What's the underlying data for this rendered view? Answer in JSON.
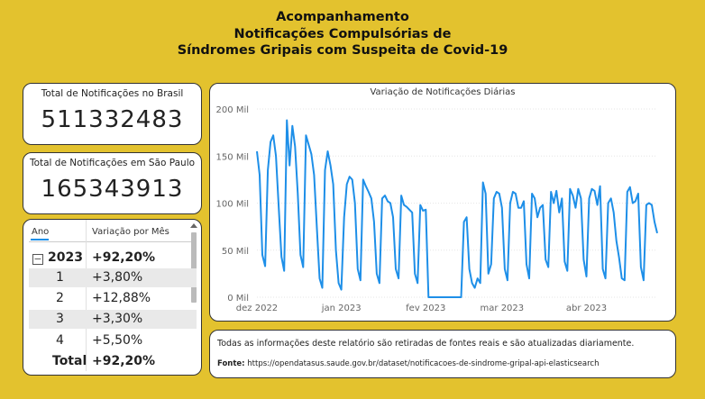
{
  "header": {
    "title_line1": "Acompanhamento",
    "title_line2": "Notificações Compulsórias de",
    "title_line3": "Síndromes Gripais com Suspeita de Covid-19"
  },
  "kpi_brasil": {
    "label": "Total de Notificações no Brasil",
    "value": "511332483"
  },
  "kpi_sp": {
    "label": "Total de Notificações em São Paulo",
    "value": "165343913"
  },
  "matrix": {
    "col_ano": "Ano",
    "col_var": "Variação por Mês",
    "group": {
      "year": "2023",
      "value": "+92,20%"
    },
    "rows": [
      {
        "mes": "1",
        "valor": "+3,80%"
      },
      {
        "mes": "2",
        "valor": "+12,88%"
      },
      {
        "mes": "3",
        "valor": "+3,30%"
      },
      {
        "mes": "4",
        "valor": "+5,50%"
      }
    ],
    "total": {
      "label": "Total",
      "value": "+92,20%"
    },
    "expander_symbol": "−"
  },
  "chart_data": {
    "type": "line",
    "title": "Variação de Notificações Diárias",
    "ylim": [
      0,
      200000
    ],
    "y_ticks": [
      {
        "value": 0,
        "label": "0 Mil"
      },
      {
        "value": 50000,
        "label": "50 Mil"
      },
      {
        "value": 100000,
        "label": "100 Mil"
      },
      {
        "value": 150000,
        "label": "150 Mil"
      },
      {
        "value": 200000,
        "label": "200 Mil"
      }
    ],
    "x_ticks": [
      {
        "date": "2022-12-01",
        "label": "dez 2022"
      },
      {
        "date": "2023-01-01",
        "label": "jan 2023"
      },
      {
        "date": "2023-02-01",
        "label": "fev 2023"
      },
      {
        "date": "2023-03-01",
        "label": "mar 2023"
      },
      {
        "date": "2023-04-01",
        "label": "abr 2023"
      }
    ],
    "x_range": [
      "2022-12-01",
      "2023-04-27"
    ],
    "line_color": "#1E8FE8",
    "grid": "horizontal",
    "points": [
      [
        "2022-12-01",
        155000
      ],
      [
        "2022-12-02",
        130000
      ],
      [
        "2022-12-03",
        45000
      ],
      [
        "2022-12-04",
        33000
      ],
      [
        "2022-12-05",
        135000
      ],
      [
        "2022-12-06",
        165000
      ],
      [
        "2022-12-07",
        172000
      ],
      [
        "2022-12-08",
        150000
      ],
      [
        "2022-12-09",
        95000
      ],
      [
        "2022-12-10",
        43000
      ],
      [
        "2022-12-11",
        28000
      ],
      [
        "2022-12-12",
        188000
      ],
      [
        "2022-12-13",
        140000
      ],
      [
        "2022-12-14",
        182000
      ],
      [
        "2022-12-15",
        160000
      ],
      [
        "2022-12-16",
        110000
      ],
      [
        "2022-12-17",
        45000
      ],
      [
        "2022-12-18",
        32000
      ],
      [
        "2022-12-19",
        172000
      ],
      [
        "2022-12-20",
        162000
      ],
      [
        "2022-12-21",
        152000
      ],
      [
        "2022-12-22",
        130000
      ],
      [
        "2022-12-23",
        75000
      ],
      [
        "2022-12-24",
        20000
      ],
      [
        "2022-12-25",
        10000
      ],
      [
        "2022-12-26",
        135000
      ],
      [
        "2022-12-27",
        155000
      ],
      [
        "2022-12-28",
        140000
      ],
      [
        "2022-12-29",
        120000
      ],
      [
        "2022-12-30",
        50000
      ],
      [
        "2022-12-31",
        15000
      ],
      [
        "2023-01-01",
        8000
      ],
      [
        "2023-01-02",
        85000
      ],
      [
        "2023-01-03",
        120000
      ],
      [
        "2023-01-04",
        128000
      ],
      [
        "2023-01-05",
        125000
      ],
      [
        "2023-01-06",
        100000
      ],
      [
        "2023-01-07",
        30000
      ],
      [
        "2023-01-08",
        18000
      ],
      [
        "2023-01-09",
        125000
      ],
      [
        "2023-01-10",
        118000
      ],
      [
        "2023-01-11",
        112000
      ],
      [
        "2023-01-12",
        105000
      ],
      [
        "2023-01-13",
        80000
      ],
      [
        "2023-01-14",
        25000
      ],
      [
        "2023-01-15",
        15000
      ],
      [
        "2023-01-16",
        105000
      ],
      [
        "2023-01-17",
        108000
      ],
      [
        "2023-01-18",
        102000
      ],
      [
        "2023-01-19",
        100000
      ],
      [
        "2023-01-20",
        85000
      ],
      [
        "2023-01-21",
        30000
      ],
      [
        "2023-01-22",
        20000
      ],
      [
        "2023-01-23",
        108000
      ],
      [
        "2023-01-24",
        98000
      ],
      [
        "2023-01-25",
        96000
      ],
      [
        "2023-01-26",
        93000
      ],
      [
        "2023-01-27",
        90000
      ],
      [
        "2023-01-28",
        25000
      ],
      [
        "2023-01-29",
        15000
      ],
      [
        "2023-01-30",
        98000
      ],
      [
        "2023-01-31",
        92000
      ],
      [
        "2023-02-01",
        93000
      ],
      [
        "2023-02-02",
        0
      ],
      [
        "2023-02-03",
        0
      ],
      [
        "2023-02-04",
        0
      ],
      [
        "2023-02-05",
        0
      ],
      [
        "2023-02-06",
        0
      ],
      [
        "2023-02-07",
        0
      ],
      [
        "2023-02-08",
        0
      ],
      [
        "2023-02-09",
        0
      ],
      [
        "2023-02-10",
        0
      ],
      [
        "2023-02-11",
        0
      ],
      [
        "2023-02-12",
        0
      ],
      [
        "2023-02-13",
        0
      ],
      [
        "2023-02-14",
        0
      ],
      [
        "2023-02-15",
        80000
      ],
      [
        "2023-02-16",
        85000
      ],
      [
        "2023-02-17",
        30000
      ],
      [
        "2023-02-18",
        15000
      ],
      [
        "2023-02-19",
        10000
      ],
      [
        "2023-02-20",
        20000
      ],
      [
        "2023-02-21",
        15000
      ],
      [
        "2023-02-22",
        122000
      ],
      [
        "2023-02-23",
        110000
      ],
      [
        "2023-02-24",
        25000
      ],
      [
        "2023-02-25",
        35000
      ],
      [
        "2023-02-26",
        105000
      ],
      [
        "2023-02-27",
        112000
      ],
      [
        "2023-02-28",
        110000
      ],
      [
        "2023-03-01",
        95000
      ],
      [
        "2023-03-02",
        30000
      ],
      [
        "2023-03-03",
        18000
      ],
      [
        "2023-03-04",
        100000
      ],
      [
        "2023-03-05",
        112000
      ],
      [
        "2023-03-06",
        110000
      ],
      [
        "2023-03-07",
        95000
      ],
      [
        "2023-03-08",
        95000
      ],
      [
        "2023-03-09",
        102000
      ],
      [
        "2023-03-10",
        35000
      ],
      [
        "2023-03-11",
        20000
      ],
      [
        "2023-03-12",
        110000
      ],
      [
        "2023-03-13",
        105000
      ],
      [
        "2023-03-14",
        85000
      ],
      [
        "2023-03-15",
        95000
      ],
      [
        "2023-03-16",
        98000
      ],
      [
        "2023-03-17",
        40000
      ],
      [
        "2023-03-18",
        32000
      ],
      [
        "2023-03-19",
        112000
      ],
      [
        "2023-03-20",
        100000
      ],
      [
        "2023-03-21",
        113000
      ],
      [
        "2023-03-22",
        90000
      ],
      [
        "2023-03-23",
        105000
      ],
      [
        "2023-03-24",
        38000
      ],
      [
        "2023-03-25",
        28000
      ],
      [
        "2023-03-26",
        115000
      ],
      [
        "2023-03-27",
        108000
      ],
      [
        "2023-03-28",
        95000
      ],
      [
        "2023-03-29",
        115000
      ],
      [
        "2023-03-30",
        105000
      ],
      [
        "2023-03-31",
        40000
      ],
      [
        "2023-04-01",
        22000
      ],
      [
        "2023-04-02",
        105000
      ],
      [
        "2023-04-03",
        115000
      ],
      [
        "2023-04-04",
        113000
      ],
      [
        "2023-04-05",
        98000
      ],
      [
        "2023-04-06",
        118000
      ],
      [
        "2023-04-07",
        30000
      ],
      [
        "2023-04-08",
        20000
      ],
      [
        "2023-04-09",
        100000
      ],
      [
        "2023-04-10",
        105000
      ],
      [
        "2023-04-11",
        90000
      ],
      [
        "2023-04-12",
        60000
      ],
      [
        "2023-04-13",
        42000
      ],
      [
        "2023-04-14",
        20000
      ],
      [
        "2023-04-15",
        18000
      ],
      [
        "2023-04-16",
        112000
      ],
      [
        "2023-04-17",
        117000
      ],
      [
        "2023-04-18",
        100000
      ],
      [
        "2023-04-19",
        102000
      ],
      [
        "2023-04-20",
        110000
      ],
      [
        "2023-04-21",
        32000
      ],
      [
        "2023-04-22",
        18000
      ],
      [
        "2023-04-23",
        98000
      ],
      [
        "2023-04-24",
        100000
      ],
      [
        "2023-04-25",
        98000
      ],
      [
        "2023-04-26",
        80000
      ],
      [
        "2023-04-27",
        68000
      ]
    ]
  },
  "footer_note": {
    "text": "Todas as informações deste relatório são retiradas de fontes reais e são atualizadas diariamente.",
    "source_label": "Fonte:",
    "source_url": "https://opendatasus.saude.gov.br/dataset/notificacoes-de-sindrome-gripal-api-elasticsearch"
  }
}
